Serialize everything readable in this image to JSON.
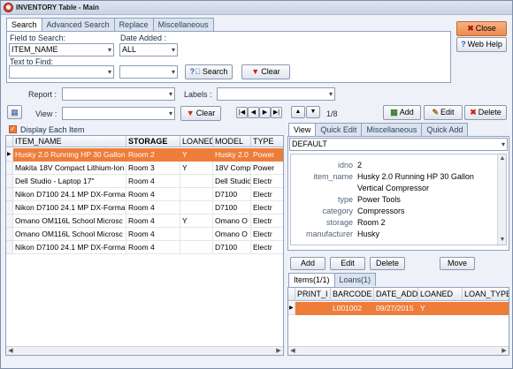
{
  "window": {
    "title": "INVENTORY Table - Main"
  },
  "search_tabs": [
    "Search",
    "Advanced Search",
    "Replace",
    "Miscellaneous"
  ],
  "search": {
    "field_label": "Field to Search:",
    "field_value": "ITEM_NAME",
    "date_label": "Date Added :",
    "date_value": "ALL",
    "find_label": "Text to Find:",
    "search_btn": "Search",
    "clear_btn": "Clear"
  },
  "top_buttons": {
    "close": "Close",
    "help": "Web Help"
  },
  "filters": {
    "report_label": "Report :",
    "labels_label": "Labels :",
    "view_label": "View :",
    "clear_btn": "Clear"
  },
  "nav": {
    "record": "1/8",
    "add": "Add",
    "edit": "Edit",
    "delete": "Delete"
  },
  "display_each": "Display Each Item",
  "grid": {
    "columns": [
      "ITEM_NAME",
      "STORAGE",
      "LOANED",
      "MODEL",
      "TYPE"
    ],
    "rows": [
      [
        "Husky 2.0 Running HP 30 Gallon",
        "Room 2",
        "Y",
        "Husky 2.0",
        "Power"
      ],
      [
        "Makita 18V Compact Lithium-Ion",
        "Room 3",
        "Y",
        "18V Comp",
        "Power"
      ],
      [
        "Dell Studio - Laptop 17\"",
        "Room 4",
        "",
        "Dell Studio",
        "Electr"
      ],
      [
        "Nikon D7100 24.1 MP DX-Format",
        "Room 4",
        "",
        "D7100",
        "Electr"
      ],
      [
        "Nikon D7100 24.1 MP DX-Format",
        "Room 4",
        "",
        "D7100",
        "Electr"
      ],
      [
        "Omano OM116L School Microsc",
        "Room 4",
        "Y",
        "Omano O",
        "Electr"
      ],
      [
        "Omano OM116L School Microsc",
        "Room 4",
        "",
        "Omano O",
        "Electr"
      ],
      [
        "Nikon D7100 24.1 MP DX-Format",
        "Room 4",
        "",
        "D7100",
        "Electr"
      ]
    ]
  },
  "view_tabs": [
    "View",
    "Quick Edit",
    "Miscellaneous",
    "Quick Add"
  ],
  "view_select": "DEFAULT",
  "details": [
    {
      "k": "idno",
      "v": "2"
    },
    {
      "k": "item_name",
      "v": "Husky 2.0 Running HP 30 Gallon"
    },
    {
      "k": "",
      "v": "Vertical Compressor"
    },
    {
      "k": "type",
      "v": "Power Tools"
    },
    {
      "k": "category",
      "v": "Compressors"
    },
    {
      "k": "storage",
      "v": "Room 2"
    },
    {
      "k": "manufacturer",
      "v": "Husky"
    }
  ],
  "sub_buttons": {
    "add": "Add",
    "edit": "Edit",
    "delete": "Delete",
    "move": "Move"
  },
  "sub_tabs": [
    "Items(1/1)",
    "Loans(1)"
  ],
  "sub_grid": {
    "columns": [
      "PRINT_I",
      "BARCODE",
      "DATE_ADDI",
      "LOANED",
      "LOAN_TYPE"
    ],
    "rows": [
      [
        "",
        "L001002",
        "09/27/2015",
        "Y",
        ""
      ]
    ]
  },
  "colors": {
    "accent": "#ee7d3a",
    "frame": "#8ea1bf",
    "close_btn": "#f29a63"
  }
}
